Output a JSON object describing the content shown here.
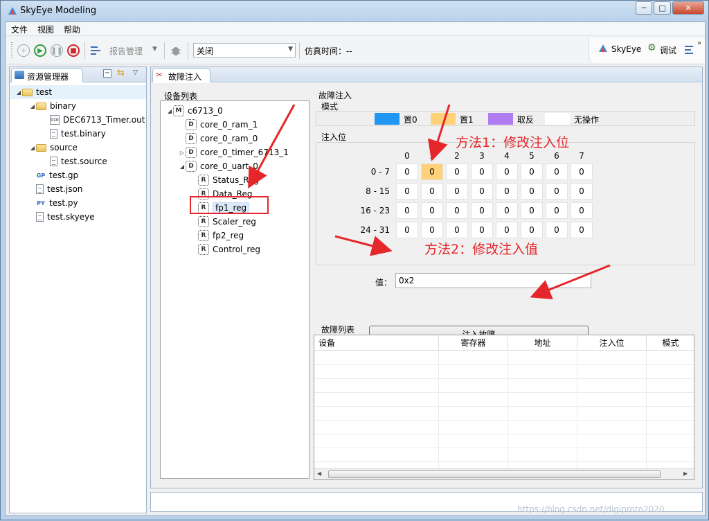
{
  "window": {
    "title": "SkyEye Modeling",
    "minimize": "─",
    "maximize": "□",
    "close": "✕"
  },
  "menu": [
    "文件",
    "视图",
    "帮助"
  ],
  "toolbar": {
    "report_label": "报告管理",
    "sim_mode_value": "关闭",
    "sim_time_label": "仿真时间：--",
    "skyeye_label": "SkyEye",
    "debug_label": "调试"
  },
  "explorer": {
    "tab_label": "资源管理器",
    "items": [
      {
        "label": "test",
        "indent": 0,
        "toggle": "◢",
        "icon": "open-folder-icon"
      },
      {
        "label": "binary",
        "indent": 1,
        "toggle": "◢",
        "icon": "folder-icon"
      },
      {
        "label": "DEC6713_Timer.out",
        "indent": 2,
        "toggle": "",
        "icon": "binary-file-icon"
      },
      {
        "label": "test.binary",
        "indent": 2,
        "toggle": "",
        "icon": "file-icon"
      },
      {
        "label": "source",
        "indent": 1,
        "toggle": "◢",
        "icon": "folder-icon"
      },
      {
        "label": "test.source",
        "indent": 2,
        "toggle": "",
        "icon": "file-icon"
      },
      {
        "label": "test.gp",
        "indent": 1,
        "toggle": "",
        "icon": "gp-file-icon"
      },
      {
        "label": "test.json",
        "indent": 1,
        "toggle": "",
        "icon": "file-icon"
      },
      {
        "label": "test.py",
        "indent": 1,
        "toggle": "",
        "icon": "python-file-icon"
      },
      {
        "label": "test.skyeye",
        "indent": 1,
        "toggle": "",
        "icon": "file-icon"
      }
    ]
  },
  "editor": {
    "tab_label": "故障注入",
    "device_list": {
      "title": "设备列表",
      "items": [
        {
          "label": "c6713_0",
          "chip": "M",
          "toggle": "◢"
        },
        {
          "label": "core_0_ram_1",
          "chip": "D",
          "toggle": ""
        },
        {
          "label": "core_0_ram_0",
          "chip": "D",
          "toggle": ""
        },
        {
          "label": "core_0_timer_6713_1",
          "chip": "D",
          "toggle": "▷"
        },
        {
          "label": "core_0_uart_0",
          "chip": "D",
          "toggle": "◢"
        },
        {
          "label": "Status_Reg",
          "chip": "R",
          "toggle": ""
        },
        {
          "label": "Data_Reg",
          "chip": "R",
          "toggle": ""
        },
        {
          "label": "fp1_reg",
          "chip": "R",
          "toggle": ""
        },
        {
          "label": "Scaler_reg",
          "chip": "R",
          "toggle": ""
        },
        {
          "label": "fp2_reg",
          "chip": "R",
          "toggle": ""
        },
        {
          "label": "Control_reg",
          "chip": "R",
          "toggle": ""
        }
      ]
    },
    "fault_inject": {
      "title": "故障注入",
      "mode_title": "模式",
      "modes": [
        {
          "label": "置0",
          "color": "#2196f3"
        },
        {
          "label": "置1",
          "color": "#ffd27a"
        },
        {
          "label": "取反",
          "color": "#b07cf2"
        },
        {
          "label": "无操作",
          "color": "#ffffff"
        }
      ],
      "bits_title": "注入位",
      "bit_headers": [
        "0",
        "1",
        "2",
        "3",
        "4",
        "5",
        "6",
        "7"
      ],
      "rows": [
        {
          "label": "0 - 7",
          "values": [
            "0",
            "0",
            "0",
            "0",
            "0",
            "0",
            "0",
            "0"
          ]
        },
        {
          "label": "8 - 15",
          "values": [
            "0",
            "0",
            "0",
            "0",
            "0",
            "0",
            "0",
            "0"
          ]
        },
        {
          "label": "16 - 23",
          "values": [
            "0",
            "0",
            "0",
            "0",
            "0",
            "0",
            "0",
            "0"
          ]
        },
        {
          "label": "24 - 31",
          "values": [
            "0",
            "0",
            "0",
            "0",
            "0",
            "0",
            "0",
            "0"
          ]
        }
      ],
      "value_label": "值：",
      "value": "0x2",
      "inject_button": "注入故障"
    },
    "fault_list": {
      "title": "故障列表",
      "columns": [
        "设备",
        "寄存器",
        "地址",
        "注入位",
        "模式"
      ]
    }
  },
  "annotations": {
    "method1": "方法1：修改注入位",
    "method2": "方法2：修改注入值"
  },
  "watermark": "https://blog.csdn.net/digiproto2020"
}
